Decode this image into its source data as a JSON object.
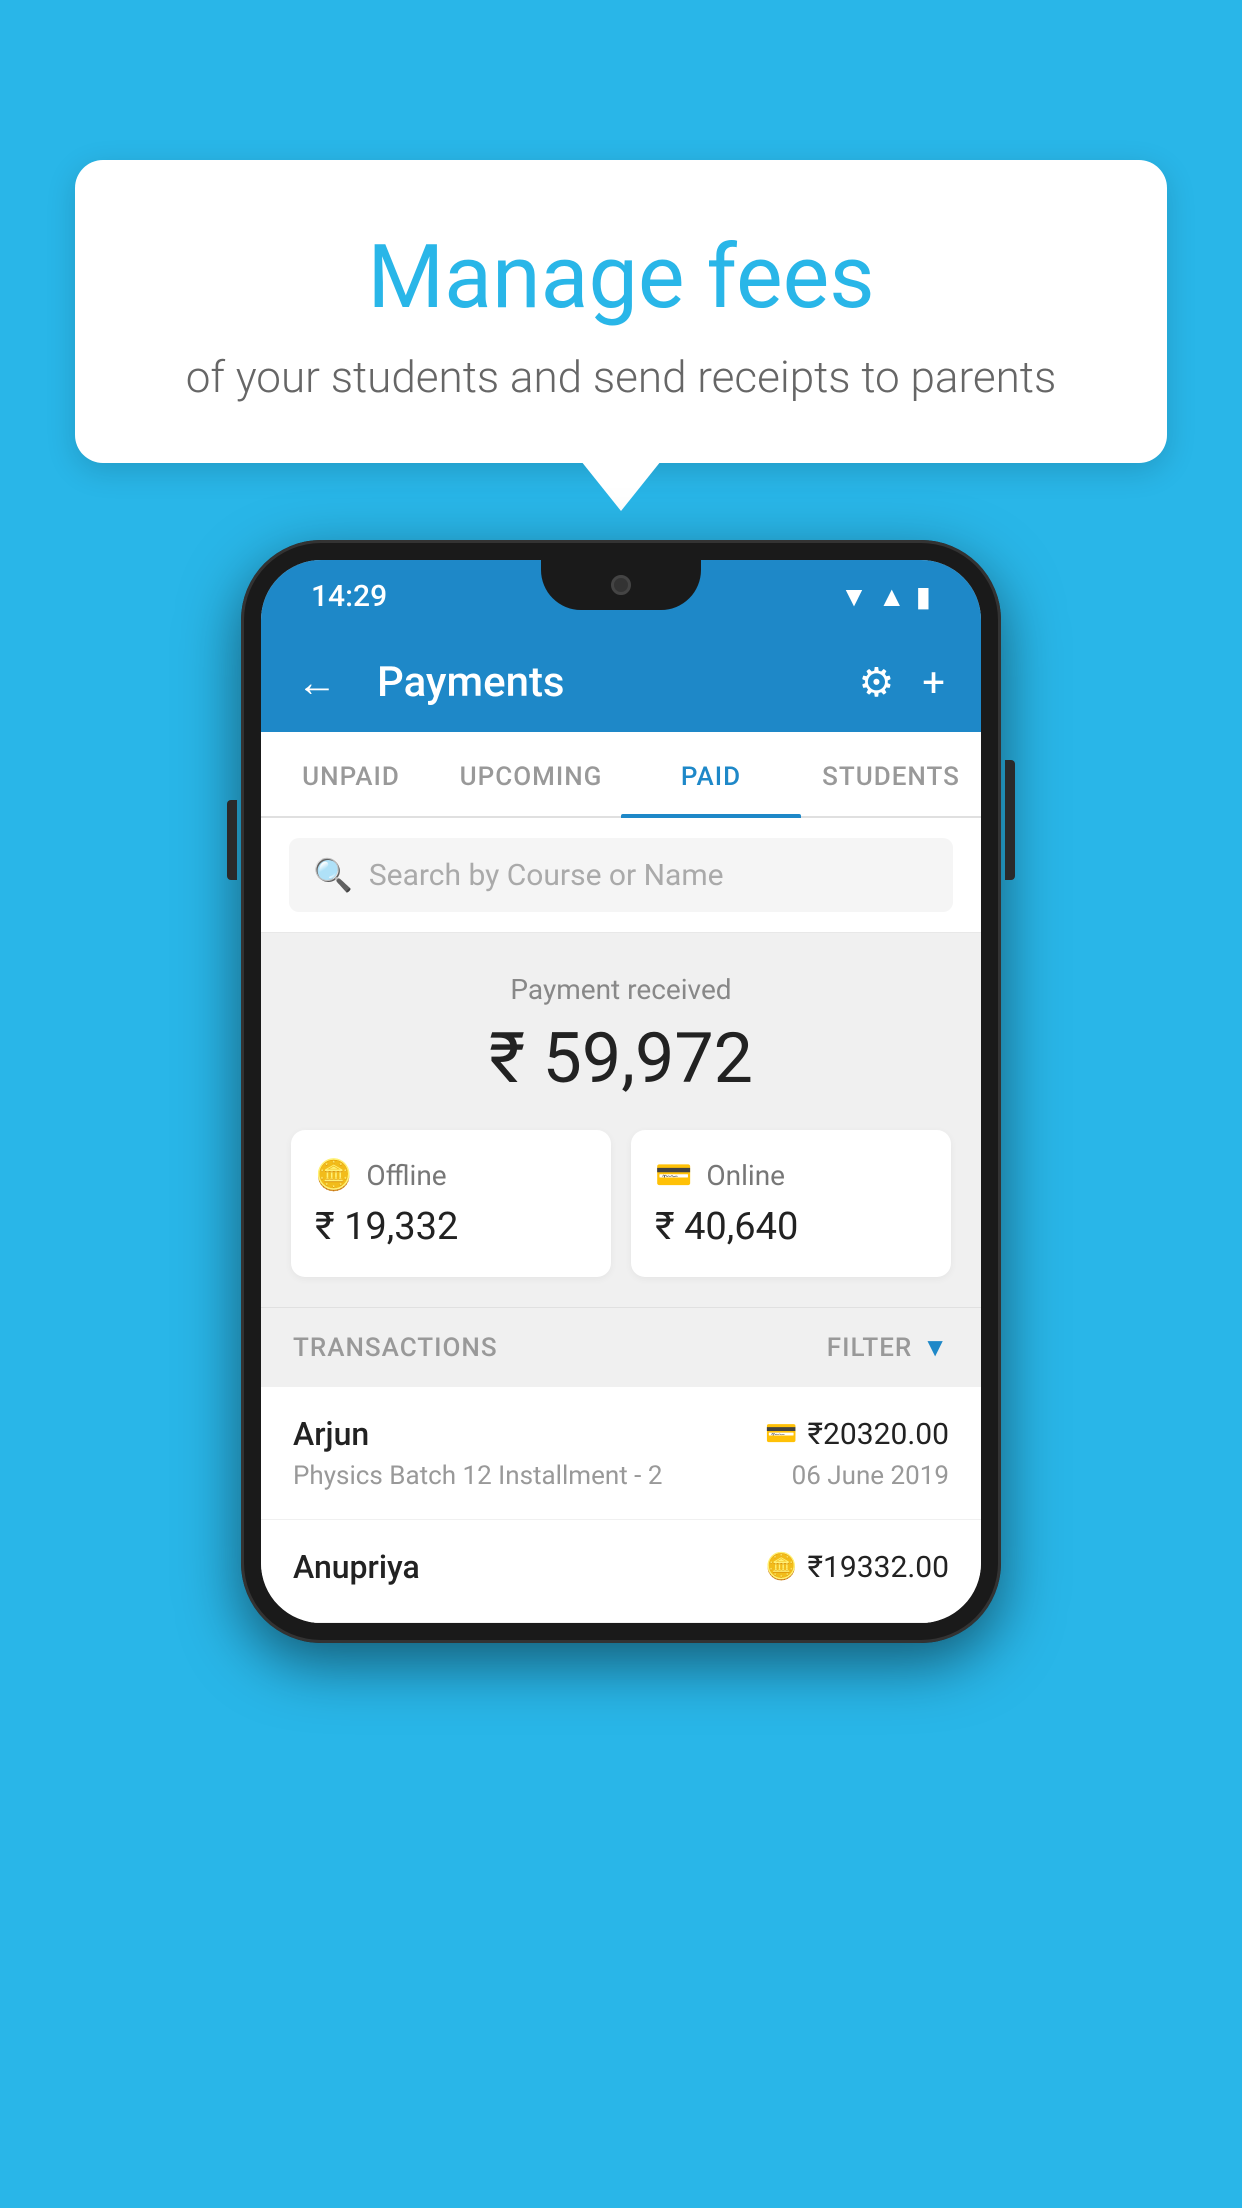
{
  "page": {
    "bg_color": "#29b6e8"
  },
  "tooltip": {
    "title": "Manage fees",
    "subtitle": "of your students and send receipts to parents"
  },
  "status_bar": {
    "time": "14:29"
  },
  "header": {
    "title": "Payments",
    "back_label": "←",
    "gear_icon": "⚙",
    "plus_icon": "+"
  },
  "tabs": [
    {
      "label": "UNPAID",
      "active": false
    },
    {
      "label": "UPCOMING",
      "active": false
    },
    {
      "label": "PAID",
      "active": true
    },
    {
      "label": "STUDENTS",
      "active": false
    }
  ],
  "search": {
    "placeholder": "Search by Course or Name"
  },
  "payment_summary": {
    "label": "Payment received",
    "amount": "₹ 59,972",
    "offline_label": "Offline",
    "offline_amount": "₹ 19,332",
    "online_label": "Online",
    "online_amount": "₹ 40,640"
  },
  "transactions": {
    "section_label": "TRANSACTIONS",
    "filter_label": "FILTER"
  },
  "transaction_list": [
    {
      "name": "Arjun",
      "amount": "₹20320.00",
      "description": "Physics Batch 12 Installment - 2",
      "date": "06 June 2019",
      "icon": "card"
    },
    {
      "name": "Anupriya",
      "amount": "₹19332.00",
      "description": "",
      "date": "",
      "icon": "cash"
    }
  ]
}
